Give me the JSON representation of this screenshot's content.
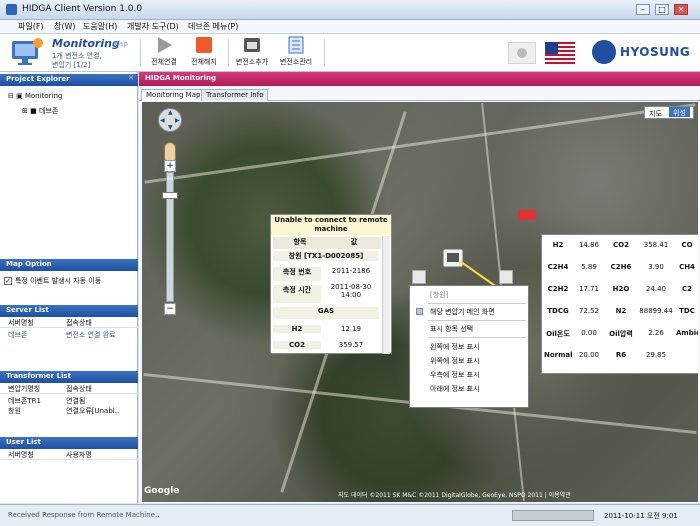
{
  "window": {
    "title": "HIDGA Client Version 1.0.0"
  },
  "menu": [
    "파일(F)",
    "창(W)",
    "도움말(H)",
    "개발자 도구(D)",
    "데브존 메뉴(P)"
  ],
  "toolbar": {
    "mon_title": "Monitoring",
    "mon_map": "Map",
    "mon_sub1": "1개 변전소 연결,",
    "mon_sub2": "변압기 [1/2]",
    "btn_connect_all": "전체연결",
    "btn_disconnect_all": "전체해지",
    "btn_add_substation": "변전소추가",
    "btn_manage_substation": "변전소관리",
    "brand": "HYOSUNG"
  },
  "left": {
    "project_explorer": "Project Explorer",
    "tree_root": "Monitoring",
    "tree_child": "데브존",
    "map_option": "Map Option",
    "map_option_label": "특정 이벤트 발생시 자동 이동",
    "server_list": "Server List",
    "server_cols": [
      "서버명칭",
      "접속상태"
    ],
    "server_rows": [
      [
        "데브존",
        "변전소 연결 완료"
      ]
    ],
    "transformer_list": "Transformer List",
    "transformer_cols": [
      "변압기명칭",
      "접속상태"
    ],
    "transformer_rows": [
      [
        "데브존TR1",
        "연결됨"
      ],
      [
        "창원",
        "연결오류[Unabl.."
      ]
    ],
    "user_list": "User List",
    "user_cols": [
      "서버명칭",
      "사용자명"
    ]
  },
  "main": {
    "header": "HIDGA Monitoring",
    "tabs": [
      "Monitoring Map",
      "Transformer Info"
    ],
    "map_type": [
      "지도",
      "위성"
    ],
    "popup": {
      "title": "Unable to connect to remote machine",
      "col_item": "항목",
      "col_value": "값",
      "name": "창원 [TX1-D002085]",
      "rows": [
        [
          "측정 번호",
          "2011-2186"
        ],
        [
          "측정 시간",
          "2011-08-30 14:00"
        ]
      ],
      "gas_label": "GAS",
      "gas_rows": [
        [
          "H2",
          "12.19"
        ],
        [
          "CO2",
          "359.57"
        ]
      ]
    },
    "context_menu": {
      "header": "[창원]",
      "items": [
        "해당 변압기 메인 화면",
        "표시 항목 선택",
        "왼쪽에 정보 표시",
        "위쪽에 정보 표시",
        "우측에 정보 표시",
        "아래에 정보 표시"
      ]
    },
    "gas_grid": [
      [
        "H2",
        "14.86",
        "CO2",
        "358.41",
        "CO"
      ],
      [
        "C2H4",
        "5.89",
        "C2H6",
        "3.90",
        "CH4"
      ],
      [
        "C2H2",
        "17.71",
        "H2O",
        "24.40",
        "C2"
      ],
      [
        "TDCG",
        "72.52",
        "N2",
        "88899.44",
        "TDC"
      ],
      [
        "Oil온도",
        "0.00",
        "Oil압력",
        "2.26",
        "Ambie"
      ],
      [
        "Normal",
        "20.00",
        "R6",
        "29.85",
        ""
      ]
    ],
    "attribution": "지도 데이터 ©2011 SK M&C ©2011 DigitalGlobe, GeoEye, NSPO 2011 | 이용약관",
    "google": "Google"
  },
  "status": {
    "message": "Received Response from Remote Machine..",
    "time": "2011-10-11 오전 9:01"
  }
}
